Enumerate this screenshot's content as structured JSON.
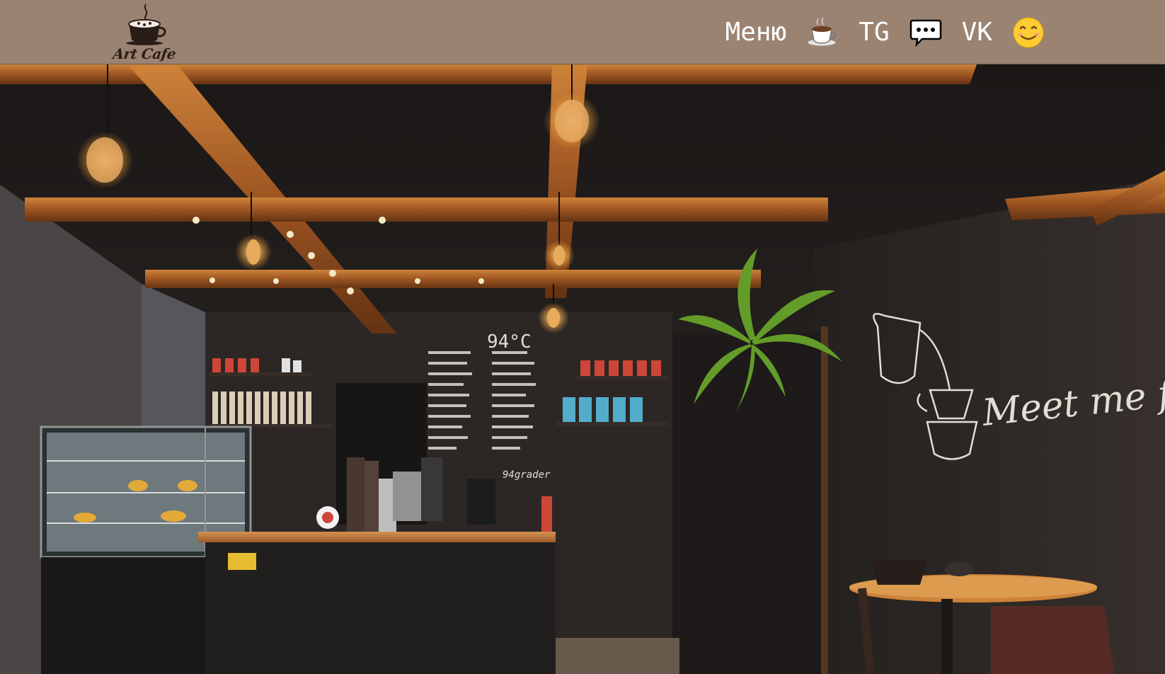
{
  "brand": {
    "name": "Art Cafe"
  },
  "nav": {
    "menu_label": "Меню",
    "menu_icon": "coffee-cup-icon",
    "tg_label": "TG",
    "tg_icon": "speech-bubble-icon",
    "vk_label": "VK",
    "vk_icon": "smiley-face-icon"
  },
  "colors": {
    "header_bg": "#9b8372",
    "nav_text": "#ffffff",
    "hero_wall": "#2b2523",
    "beam": "#a65a24"
  },
  "hero": {
    "chalkboard_temp": "94°C",
    "chalkboard_footer": "94grader",
    "wall_lettering": "Meet me for C"
  }
}
